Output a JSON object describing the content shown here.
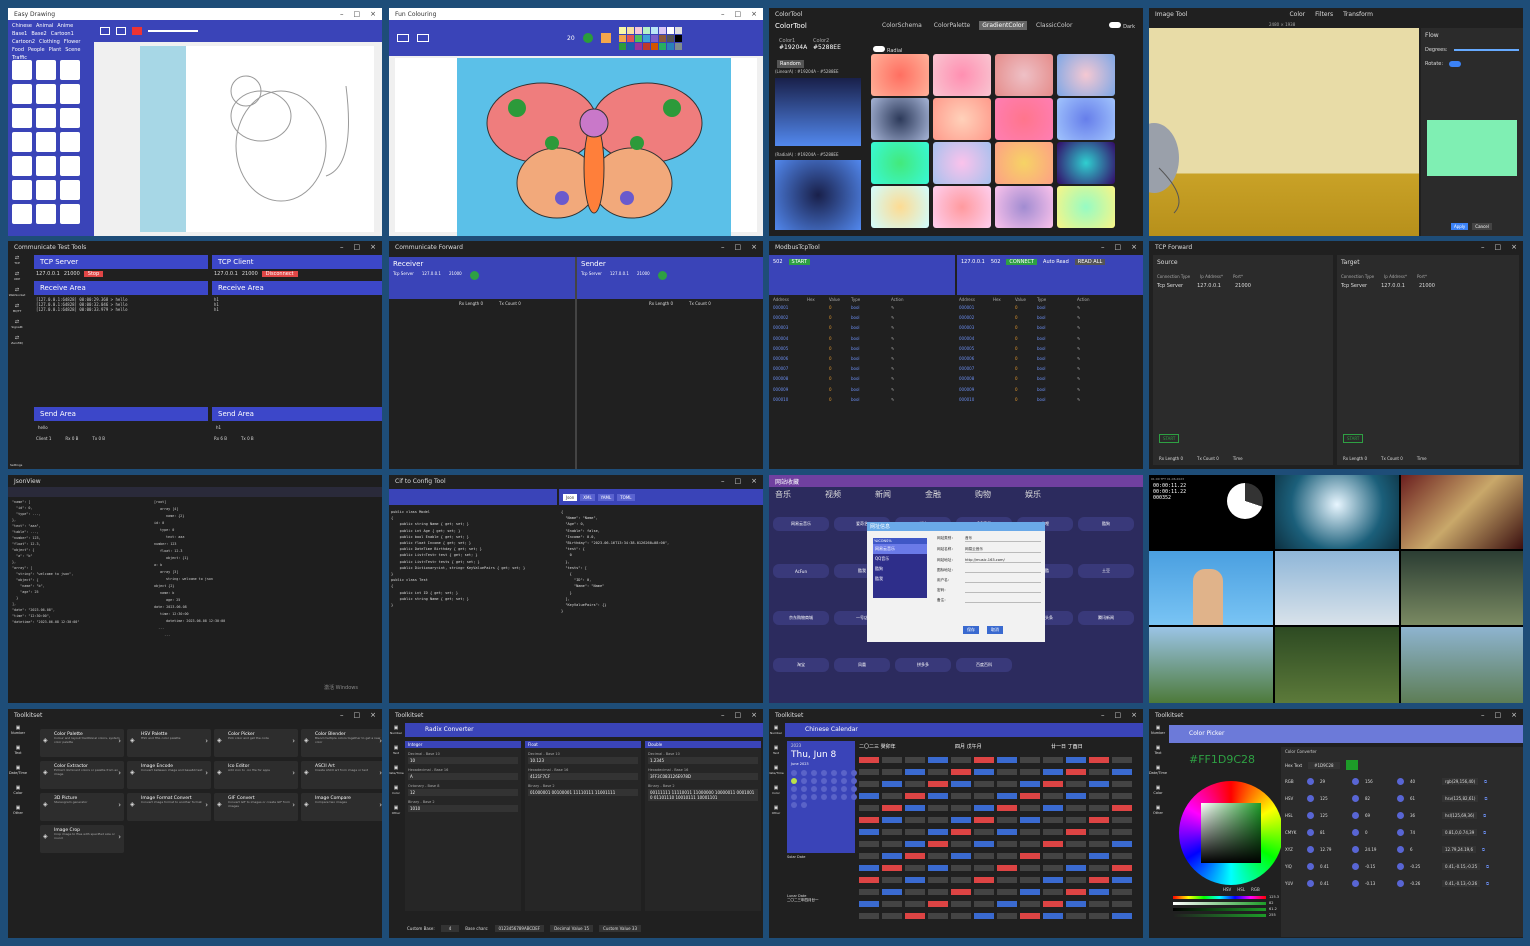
{
  "tile1": {
    "title": "Easy Drawing",
    "tabs": [
      "Chinese",
      "Animal",
      "Anime",
      "Base1",
      "Base2",
      "Cartoon1",
      "Cartoon2",
      "Clothing",
      "Flower",
      "Food",
      "People",
      "Plant",
      "Scene",
      "Traffic"
    ]
  },
  "tile2": {
    "title": "Fun Colouring",
    "zoom": "20"
  },
  "tile3": {
    "title": "ColorTool",
    "app": "ColorTool",
    "tabs": [
      "ColorSchema",
      "ColorPalette",
      "GradientColor",
      "ClassicColor"
    ],
    "active_tab": "GradientColor",
    "dark_label": "Dark",
    "color1_label": "Color1",
    "color1": "#19204A",
    "color2_label": "Color2",
    "color2": "#5288EE",
    "radial_label": "Radial",
    "random_button": "Random",
    "linear_label": "(LinearA) : #19204A - #5288EE",
    "radial_text": "(RadialA) : #19204A - #5288EE"
  },
  "tile4": {
    "title": "Image Tool",
    "menu": [
      "Color",
      "Filters",
      "Transform"
    ],
    "size_text": "2480 × 1938",
    "panel_title": "Flow",
    "degrees_label": "Degrees:",
    "rotate_label": "Rotate:",
    "apply_button": "Apply",
    "cancel_button": "Cancel"
  },
  "tile5": {
    "title": "Communicate Test Tools",
    "side_items": [
      "TCP",
      "UDP",
      "WebSocket",
      "MQTT",
      "SignalR",
      "ZeroMQ"
    ],
    "settings_label": "Settings",
    "server_title": "TCP Server",
    "server_ip": "127.0.0.1",
    "server_port": "21000",
    "stop_button": "Stop",
    "client_title": "TCP Client",
    "client_ip": "127.0.0.1",
    "client_port": "21000",
    "disconnect_button": "Disconnect",
    "receive_area": "Receive Area",
    "server_lines": [
      "[127.0.0.1:64828] 00:00:29.368 > hello",
      "[127.0.0.1:64828] 00:00:32.046 > hello",
      "[127.0.0.1:64828] 00:00:33.979 > hello"
    ],
    "client_lines": [
      "h1",
      "h1",
      "h1"
    ],
    "send_area": "Send Area",
    "send_value": "1000",
    "send_text": "h1",
    "send_text2": "hello",
    "status": [
      "Client 1",
      "Rx 0 B",
      "Tx 0 B"
    ],
    "status2": [
      "Rx 6 B",
      "Tx 0 B"
    ]
  },
  "tile6": {
    "title": "Communicate Forward",
    "receiver_title": "Receiver",
    "sender_title": "Sender",
    "type_label": "Type",
    "type_value": "Tcp Server",
    "ip_label": "Ip Address",
    "ip_value": "127.0.0.1",
    "port_label": "Port",
    "port_value": "21000",
    "rx_length": "Rx Length 0",
    "tx_count": "Tx Count 0",
    "s_type_value": "Tcp Server",
    "s_ip_value": "127.0.0.1",
    "s_port_value": "21000"
  },
  "tile7": {
    "title": "ModbusTcpTool",
    "port_left": "502",
    "start_button": "START",
    "ip_right": "127.0.0.1",
    "port_right": "502",
    "connect_button": "CONNECT",
    "auto_read": "Auto Read",
    "read_button": "READ ALL",
    "columns": [
      "Address",
      "Hex",
      "Value",
      "Type",
      "Action"
    ],
    "rows": [
      "000001",
      "000002",
      "000003",
      "000004",
      "000005",
      "000006",
      "000007",
      "000008",
      "000009",
      "000010"
    ],
    "row_value": "0",
    "row_type": "bool"
  },
  "tile8": {
    "title": "TCP Forward",
    "source_title": "Source",
    "target_title": "Target",
    "conn_type_label": "Connection Type",
    "conn_type": "Tcp Server",
    "ip_label": "Ip Address*",
    "ip_value": "127.0.0.1",
    "port_label": "Port*",
    "port_value": "21000",
    "start_button": "START",
    "rx_length": "Rx Length 0",
    "tx_count": "Tx Count 0",
    "time_label": "Time"
  },
  "tile9": {
    "title": "JsonView",
    "left_lines": [
      "\"name\": [",
      "  \"id\": 0,",
      "  \"type\": ...,",
      "},",
      "\"text\": \"aaa\",",
      "\"table\": ...,",
      "\"number\": 123,",
      "\"float\": 12.3,",
      "\"object\": {",
      "  \"a\": \"b\"",
      "},",
      "\"array\": [",
      "  \"string\": \"welcome to json\",",
      "  \"object\": {",
      "    \"name\": \"b\",",
      "    \"age\": 25",
      "  }",
      "],",
      "\"date\": \"2023-06-08\",",
      "\"time\": \"12:30:00\",",
      "\"datetime\": \"2023-06-08 12:30:00\""
    ],
    "right_nodes": [
      "[root]",
      "array [4]",
      "name: {2}",
      "id: 0",
      "type: 0",
      "text: aaa",
      "number: 123",
      "float: 12.3",
      "object: {1}",
      "a: b",
      "array [3]",
      "string: welcome to json",
      "object {2}",
      "name: b",
      "age: 25",
      "date: 2023-06-08",
      "time: 12:30:00",
      "datetime: 2023-06-08 12:30:00",
      "  ...",
      "  ..."
    ],
    "watermark": "激活 Windows"
  },
  "tile10": {
    "title": "Cif to Config Tool",
    "tabs": [
      "Json",
      "XML",
      "YAML",
      "TOML"
    ],
    "active_tab": "Json",
    "code_left": [
      "public class Model",
      "{",
      "    public string Name { get; set; }",
      "    public int Age { get; set; }",
      "    public bool Enable { get; set; }",
      "    public float Income { get; set; }",
      "    public DateTime Birthday { get; set; }",
      "    public List<Test> test { get; set; }",
      "    public List<Test> tests { get; set; }",
      "    public Dictionary<int, string> KeyValuePairs { get; set; }",
      "}",
      "",
      "public class Test",
      "{",
      "    public int ID { get; set; }",
      "    public string Name { get; set; }",
      "}"
    ],
    "code_right": [
      "{",
      "  \"Name\": \"Name\",",
      "  \"Age\": 0,",
      "  \"Enable\": false,",
      "  \"Income\": 0.0,",
      "  \"Birthday\": \"2023-06-16T13:34:38.0126260+08:00\",",
      "  \"test\": {",
      "    0",
      "  },",
      "  \"tests\": [",
      "    {",
      "      \"ID\": 0,",
      "      \"Name\": \"Name\"",
      "    }",
      "  ],",
      "  \"KeyValuePairs\": {}",
      "}"
    ]
  },
  "tile11": {
    "title": "网站收藏",
    "cats": [
      "音乐",
      "视频",
      "新闻",
      "金融",
      "购物",
      "娱乐"
    ],
    "dialog_title": "网址信息",
    "list_items": [
      "网易云音乐",
      "QQ音乐",
      "酷狗",
      "酷我"
    ],
    "list_hd": "%ICONS%",
    "category_label": "网站类别：",
    "category_value": "音乐",
    "name_label": "网站名称：",
    "name_value": "网易云音乐",
    "url_label": "网站地址：",
    "url_value": "http://music.163.com/",
    "icon_label": "图标地址：",
    "user_label": "用户名：",
    "pwd_label": "密码：",
    "note_label": "备注：",
    "save_button": "保存",
    "cancel_button": "取消",
    "buttons": [
      "网易云音乐",
      "爱奇艺",
      "新浪",
      "QQ音乐",
      "哔哩",
      "酷狗",
      "AcFun",
      "酷我",
      "腾讯视频",
      "搜狐视频",
      "优酷",
      "土豆",
      "京东购物商城",
      "一号店",
      "苏宁易购",
      "云日记",
      "今日头条",
      "腾讯新闻",
      "淘宝",
      "凤凰",
      "拼多多",
      "百度百科"
    ]
  },
  "tile12": {
    "clock_a": "00:00:11.22",
    "clock_b": "00:00:11.22",
    "counter": "000352",
    "top_text": "01:00 TFT 01.06.2023"
  },
  "tile13": {
    "title": "Toolkitset",
    "side": [
      "Number",
      "Text",
      "Date/Time",
      "Color",
      "Other"
    ],
    "cards": [
      {
        "t": "Color Palette",
        "d": "Colour and layout traditional colors, system color palette"
      },
      {
        "t": "HSV Palette",
        "d": "HSV and HSL color palette"
      },
      {
        "t": "Color Picker",
        "d": "Pick color and get the code"
      },
      {
        "t": "Color Blender",
        "d": "Blend multiple colors together to get a new color"
      },
      {
        "t": "Color Extractor",
        "d": "Extract dominant colors or palette from an image"
      },
      {
        "t": "Image Encode",
        "d": "Convert between image and base64 text"
      },
      {
        "t": "Ico Editor",
        "d": "Add icon to .ico file for apps"
      },
      {
        "t": "ASCII Art",
        "d": "Create ASCII art from image or text"
      },
      {
        "t": "3D Picture",
        "d": "Stereogram generator"
      },
      {
        "t": "Image Format Convert",
        "d": "Convert image format to another format"
      },
      {
        "t": "GIF Convert",
        "d": "Convert GIF to images or create GIF from images"
      },
      {
        "t": "Image Compare",
        "d": "Compare two images"
      },
      {
        "t": "Image Crop",
        "d": "Crop image to files with specified size or round"
      }
    ]
  },
  "tile14": {
    "title": "Toolkitset",
    "header": "Radix Converter",
    "side": [
      "Number",
      "Text",
      "Date/Time",
      "Color",
      "Other"
    ],
    "cols": [
      "Integer",
      "Float",
      "Double"
    ],
    "int_fields": [
      {
        "l": "Decimal - Base 10",
        "v": "10"
      },
      {
        "l": "Hexadecimal - Base 16",
        "v": "A"
      },
      {
        "l": "Octonary - Base 8",
        "v": "12"
      },
      {
        "l": "Binary - Base 2",
        "v": "1010"
      }
    ],
    "float_fields": [
      {
        "l": "Decimal - Base 10",
        "v": "10.123"
      },
      {
        "l": "Hexadecimal - Base 16",
        "v": "4121F7CF"
      },
      {
        "l": "Binary - Base 2",
        "v": "01000001 00100001 11110111 11001111"
      }
    ],
    "double_fields": [
      {
        "l": "Decimal - Base 10",
        "v": "1.2345"
      },
      {
        "l": "Hexadecimal - Base 16",
        "v": "3FF3C083126E978D"
      },
      {
        "l": "Binary - Base 2",
        "v": "00111111 11110011 11000000 10000011 00010010 01101110 10010111 10001101"
      }
    ],
    "custom_base_label": "Custom Base:",
    "custom_base": "4",
    "base_chars_label": "Base chars:",
    "base_chars": "0123456789ABCDEF",
    "decimal_value_label": "Decimal Value",
    "decimal_value": "15",
    "custom_value_label": "Custom Value",
    "custom_value": "33"
  },
  "tile15": {
    "title": "Toolkitset",
    "header": "Chinese Calendar",
    "side": [
      "Number",
      "Text",
      "Date/Time",
      "Color",
      "Other"
    ],
    "year": "2023",
    "date": "Thu, Jun 8",
    "month_label": "June 2023",
    "solar_label": "Solar Date",
    "lunar_label": "Lunar Date",
    "lunar_text": "二〇二三年四月廿一",
    "cols": [
      "二〇二三 癸卯年",
      "四月 戊午月",
      "廿一日 丁酉日"
    ]
  },
  "tile16": {
    "title": "Toolkitset",
    "header": "Color Picker",
    "side": [
      "Number",
      "Text",
      "Date/Time",
      "Color",
      "Other"
    ],
    "hex": "#FF1D9C28",
    "conv_title": "Color Converter",
    "hex_label": "Hex Text",
    "hex_value": "#1D9C28",
    "rows": [
      {
        "l": "RGB",
        "a": "29",
        "b": "156",
        "c": "40",
        "out": "rgb(29,156,40)"
      },
      {
        "l": "HSV",
        "a": "125",
        "b": "82",
        "c": "61",
        "out": "hsv(125,82,61)"
      },
      {
        "l": "HSL",
        "a": "125",
        "b": "69",
        "c": "36",
        "out": "hsl(125,69,36)"
      },
      {
        "l": "CMYK",
        "a": "81",
        "b": "0",
        "c": "74",
        "out": "0.81,0,0.74,39"
      },
      {
        "l": "XYZ",
        "a": "12.79",
        "b": "24.19",
        "c": "6",
        "out": "12.79,24.19,6"
      },
      {
        "l": "YIQ",
        "a": "0.41",
        "b": "-0.15",
        "c": "-0.25",
        "out": "0.41,-0.15,-0.25"
      },
      {
        "l": "YUV",
        "a": "0.41",
        "b": "-0.13",
        "c": "-0.26",
        "out": "0.41,-0.13,-0.26"
      }
    ],
    "hsv_tabs": [
      "HSV",
      "HSL",
      "RGB"
    ],
    "sliders": [
      "125.3",
      "82",
      "61.2",
      "255"
    ]
  }
}
